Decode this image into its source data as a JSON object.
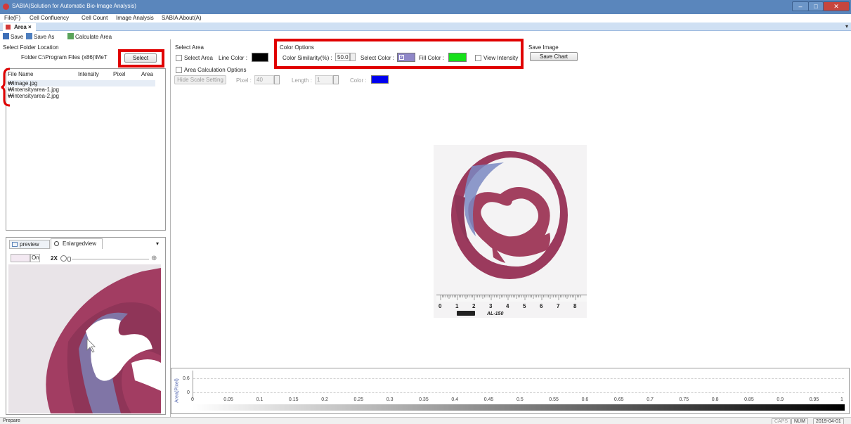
{
  "window": {
    "title": "SABIA(Solution for Automatic Bio-Image Analysis)",
    "controls": {
      "minimize": "–",
      "maximize": "□",
      "close": "✕"
    }
  },
  "menu": [
    "File(F)",
    "Cell Confluency",
    "Cell Count",
    "Image Analysis",
    "SABIA About(A)"
  ],
  "tabs": [
    {
      "label": "Area",
      "close": "×"
    }
  ],
  "tab_overflow": "▾",
  "toolbar": {
    "save": "Save",
    "save_as": "Save As",
    "calculate": "Calculate Area"
  },
  "folder": {
    "section": "Select Folder Location",
    "label": "Folder",
    "path": "C:\\Program Files (x86)\\MeT",
    "select_button": "Select"
  },
  "file_list": {
    "columns": [
      "File Name",
      "Intensity",
      "Pixel",
      "Area"
    ],
    "rows": [
      "₩image.jpg",
      "₩intensityarea-1.jpg",
      "₩intensityarea-2.jpg"
    ]
  },
  "select_area": {
    "section": "Select Area",
    "checkbox_label": "Select Area",
    "line_color_label": "Line Color :",
    "line_color": "#000000"
  },
  "area_calc": {
    "checkbox_label": "Area Calculation Options",
    "scale_button": "Hide Scale Setting",
    "pixel_label": "Pixel :",
    "pixel_value": "40",
    "length_label": "Length :",
    "length_value": "1",
    "color_label": "Color :",
    "color": "#0000ee"
  },
  "color_options": {
    "section": "Color Options",
    "similarity_label": "Color Similarity(%) :",
    "similarity_value": "50.0",
    "select_color_label": "Select Color :",
    "select_color": "#8f87c8",
    "fill_color_label": "Fill Color :",
    "fill_color": "#17e11a",
    "view_intensity_label": "View Intensity"
  },
  "save_image": {
    "section": "Save Image",
    "button": "Save Chart"
  },
  "preview": {
    "tab_preview": "preview",
    "tab_enlarged": "Enlargedview",
    "dropdown": "▾",
    "toggle_label": "On",
    "zoom_label": "2X",
    "zoom_plus": "⊕"
  },
  "ruler": {
    "numbers": [
      "0",
      "1",
      "2",
      "3",
      "4",
      "5",
      "6",
      "7",
      "8"
    ],
    "brand": "AL-150"
  },
  "chart_data": {
    "type": "line",
    "ylabel": "Area(Pixel)",
    "y_ticks": [
      "0.6",
      "0"
    ],
    "x_ticks": [
      "0",
      "0.05",
      "0.1",
      "0.15",
      "0.2",
      "0.25",
      "0.3",
      "0.35",
      "0.4",
      "0.45",
      "0.5",
      "0.55",
      "0.6",
      "0.65",
      "0.7",
      "0.75",
      "0.8",
      "0.85",
      "0.9",
      "0.95",
      "1"
    ],
    "xlim": [
      0,
      1
    ],
    "series": []
  },
  "status": {
    "left": "Prepare",
    "caps": "CAPS",
    "num": "NUM",
    "date": "2019-04-01"
  }
}
